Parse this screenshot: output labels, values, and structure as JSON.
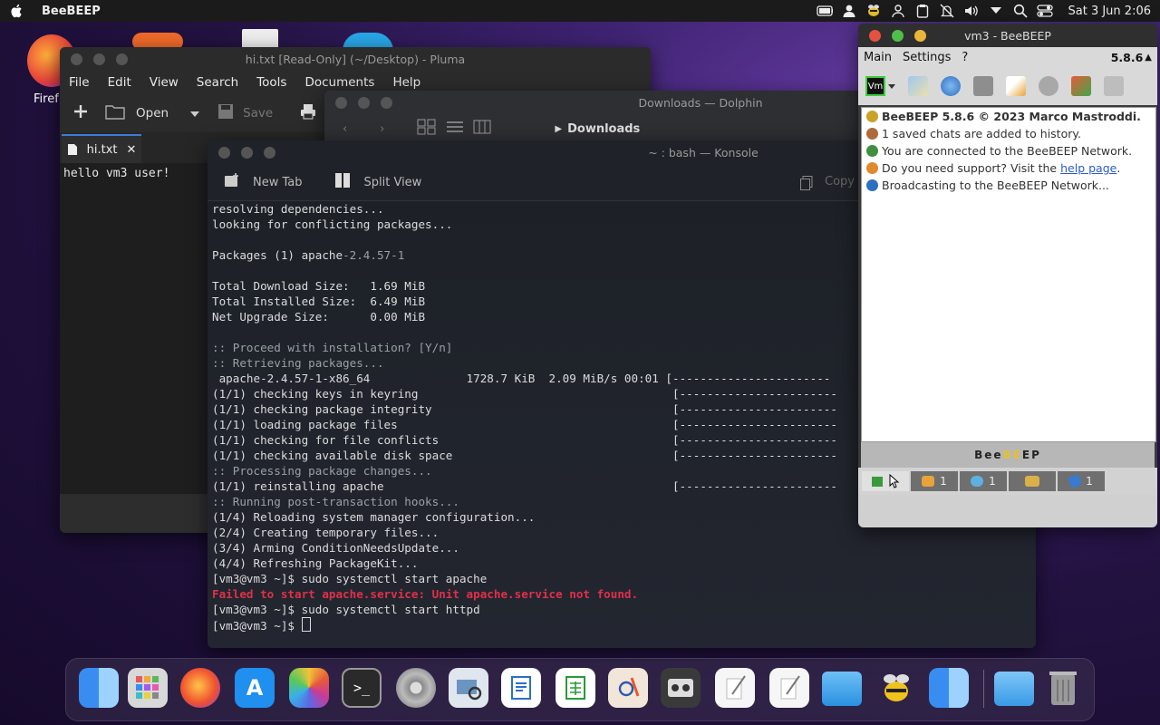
{
  "menubar": {
    "app_name": "BeeBEEP",
    "clock": "Sat 3 Jun 2:06",
    "tray_icons": [
      "battery-icon",
      "user-icon",
      "beebeep-icon",
      "person-pin-icon",
      "clipboard-icon",
      "notifications-off-icon",
      "volume-icon",
      "dropdown-icon",
      "search-icon",
      "toggle-icon"
    ]
  },
  "desktop": {
    "firefox_label": "Firef"
  },
  "pluma": {
    "title": "hi.txt [Read-Only] (~/Desktop) - Pluma",
    "menu": [
      "File",
      "Edit",
      "View",
      "Search",
      "Tools",
      "Documents",
      "Help"
    ],
    "toolbar": {
      "open": "Open",
      "save": "Save"
    },
    "tab_label": "hi.txt",
    "content": "hello vm3 user!"
  },
  "dolphin": {
    "title": "Downloads — Dolphin",
    "location": "Downloads"
  },
  "konsole": {
    "title": "~ : bash — Konsole",
    "new_tab": "New Tab",
    "split_view": "Split View",
    "copy": "Copy",
    "lines": [
      {
        "t": "resolving dependencies...",
        "c": ""
      },
      {
        "t": "looking for conflicting packages...",
        "c": ""
      },
      {
        "t": "",
        "c": ""
      },
      {
        "t": "Packages (1) apache",
        "v": "-2.4.57-1",
        "c": ""
      },
      {
        "t": "",
        "c": ""
      },
      {
        "t": "Total Download Size:   1.69 MiB",
        "c": ""
      },
      {
        "t": "Total Installed Size:  6.49 MiB",
        "c": ""
      },
      {
        "t": "Net Upgrade Size:      0.00 MiB",
        "c": ""
      },
      {
        "t": "",
        "c": ""
      },
      {
        "t": ":: Proceed with installation? [Y/n]",
        "c": "cmt"
      },
      {
        "t": ":: Retrieving packages...",
        "c": "cmt"
      },
      {
        "t": " apache-2.4.57-1-x86_64              1728.7 KiB  2.09 MiB/s 00:01 [-----------------------",
        "c": ""
      },
      {
        "t": "(1/1) checking keys in keyring                                     [-----------------------",
        "c": ""
      },
      {
        "t": "(1/1) checking package integrity                                   [-----------------------",
        "c": ""
      },
      {
        "t": "(1/1) loading package files                                        [-----------------------",
        "c": ""
      },
      {
        "t": "(1/1) checking for file conflicts                                  [-----------------------",
        "c": ""
      },
      {
        "t": "(1/1) checking available disk space                                [-----------------------",
        "c": ""
      },
      {
        "t": ":: Processing package changes...",
        "c": "cmt"
      },
      {
        "t": "(1/1) reinstalling apache                                          [-----------------------",
        "c": ""
      },
      {
        "t": ":: Running post-transaction hooks...",
        "c": "cmt"
      },
      {
        "t": "(1/4) Reloading system manager configuration...",
        "c": ""
      },
      {
        "t": "(2/4) Creating temporary files...",
        "c": ""
      },
      {
        "t": "(3/4) Arming ConditionNeedsUpdate...",
        "c": ""
      },
      {
        "t": "(4/4) Refreshing PackageKit...",
        "c": ""
      },
      {
        "t": "[vm3@vm3 ~]$ sudo systemctl start apache",
        "c": ""
      },
      {
        "t": "Failed to start apache.service: Unit apache.service not found.",
        "c": "err"
      },
      {
        "t": "[vm3@vm3 ~]$ sudo systemctl start httpd",
        "c": ""
      },
      {
        "t": "[vm3@vm3 ~]$ ",
        "c": "",
        "cursor": true
      }
    ]
  },
  "beebeep": {
    "title": "vm3 - BeeBEEP",
    "menu": [
      "Main",
      "Settings",
      "?"
    ],
    "version_badge": "5.8.6",
    "user_badge": "Vm",
    "log": [
      {
        "text": "BeeBEEP 5.8.6 © 2023 Marco Mastroddi.",
        "bold": "BeeBEEP 5.8.6 © 2023 Marco Mastroddi",
        "icon": "#c9a227"
      },
      {
        "text": "1 saved chats are added to history.",
        "icon": "#b06a3a"
      },
      {
        "text": "You are connected to the BeeBEEP Network.",
        "icon": "#3f8f3f"
      },
      {
        "pre": "Do you need support? Visit the ",
        "link": "help page",
        "post": ".",
        "icon": "#e08a2c"
      },
      {
        "text": "Broadcasting to the BeeBEEP Network...",
        "icon": "#2f6fc0"
      }
    ],
    "brand_bar": "BeeBEEP",
    "tabs": [
      {
        "name": "home",
        "count": ""
      },
      {
        "name": "users",
        "count": "1"
      },
      {
        "name": "chats",
        "count": "1"
      },
      {
        "name": "groups",
        "count": ""
      },
      {
        "name": "files",
        "count": "1"
      }
    ]
  },
  "dock": {
    "apps": [
      "finder",
      "launchpad",
      "firefox",
      "app-store",
      "photos",
      "terminal",
      "settings",
      "preview",
      "writer",
      "calc",
      "draw",
      "media",
      "textedit",
      "textedit2",
      "files",
      "beebeep",
      "finder2",
      "downloads",
      "trash"
    ]
  }
}
